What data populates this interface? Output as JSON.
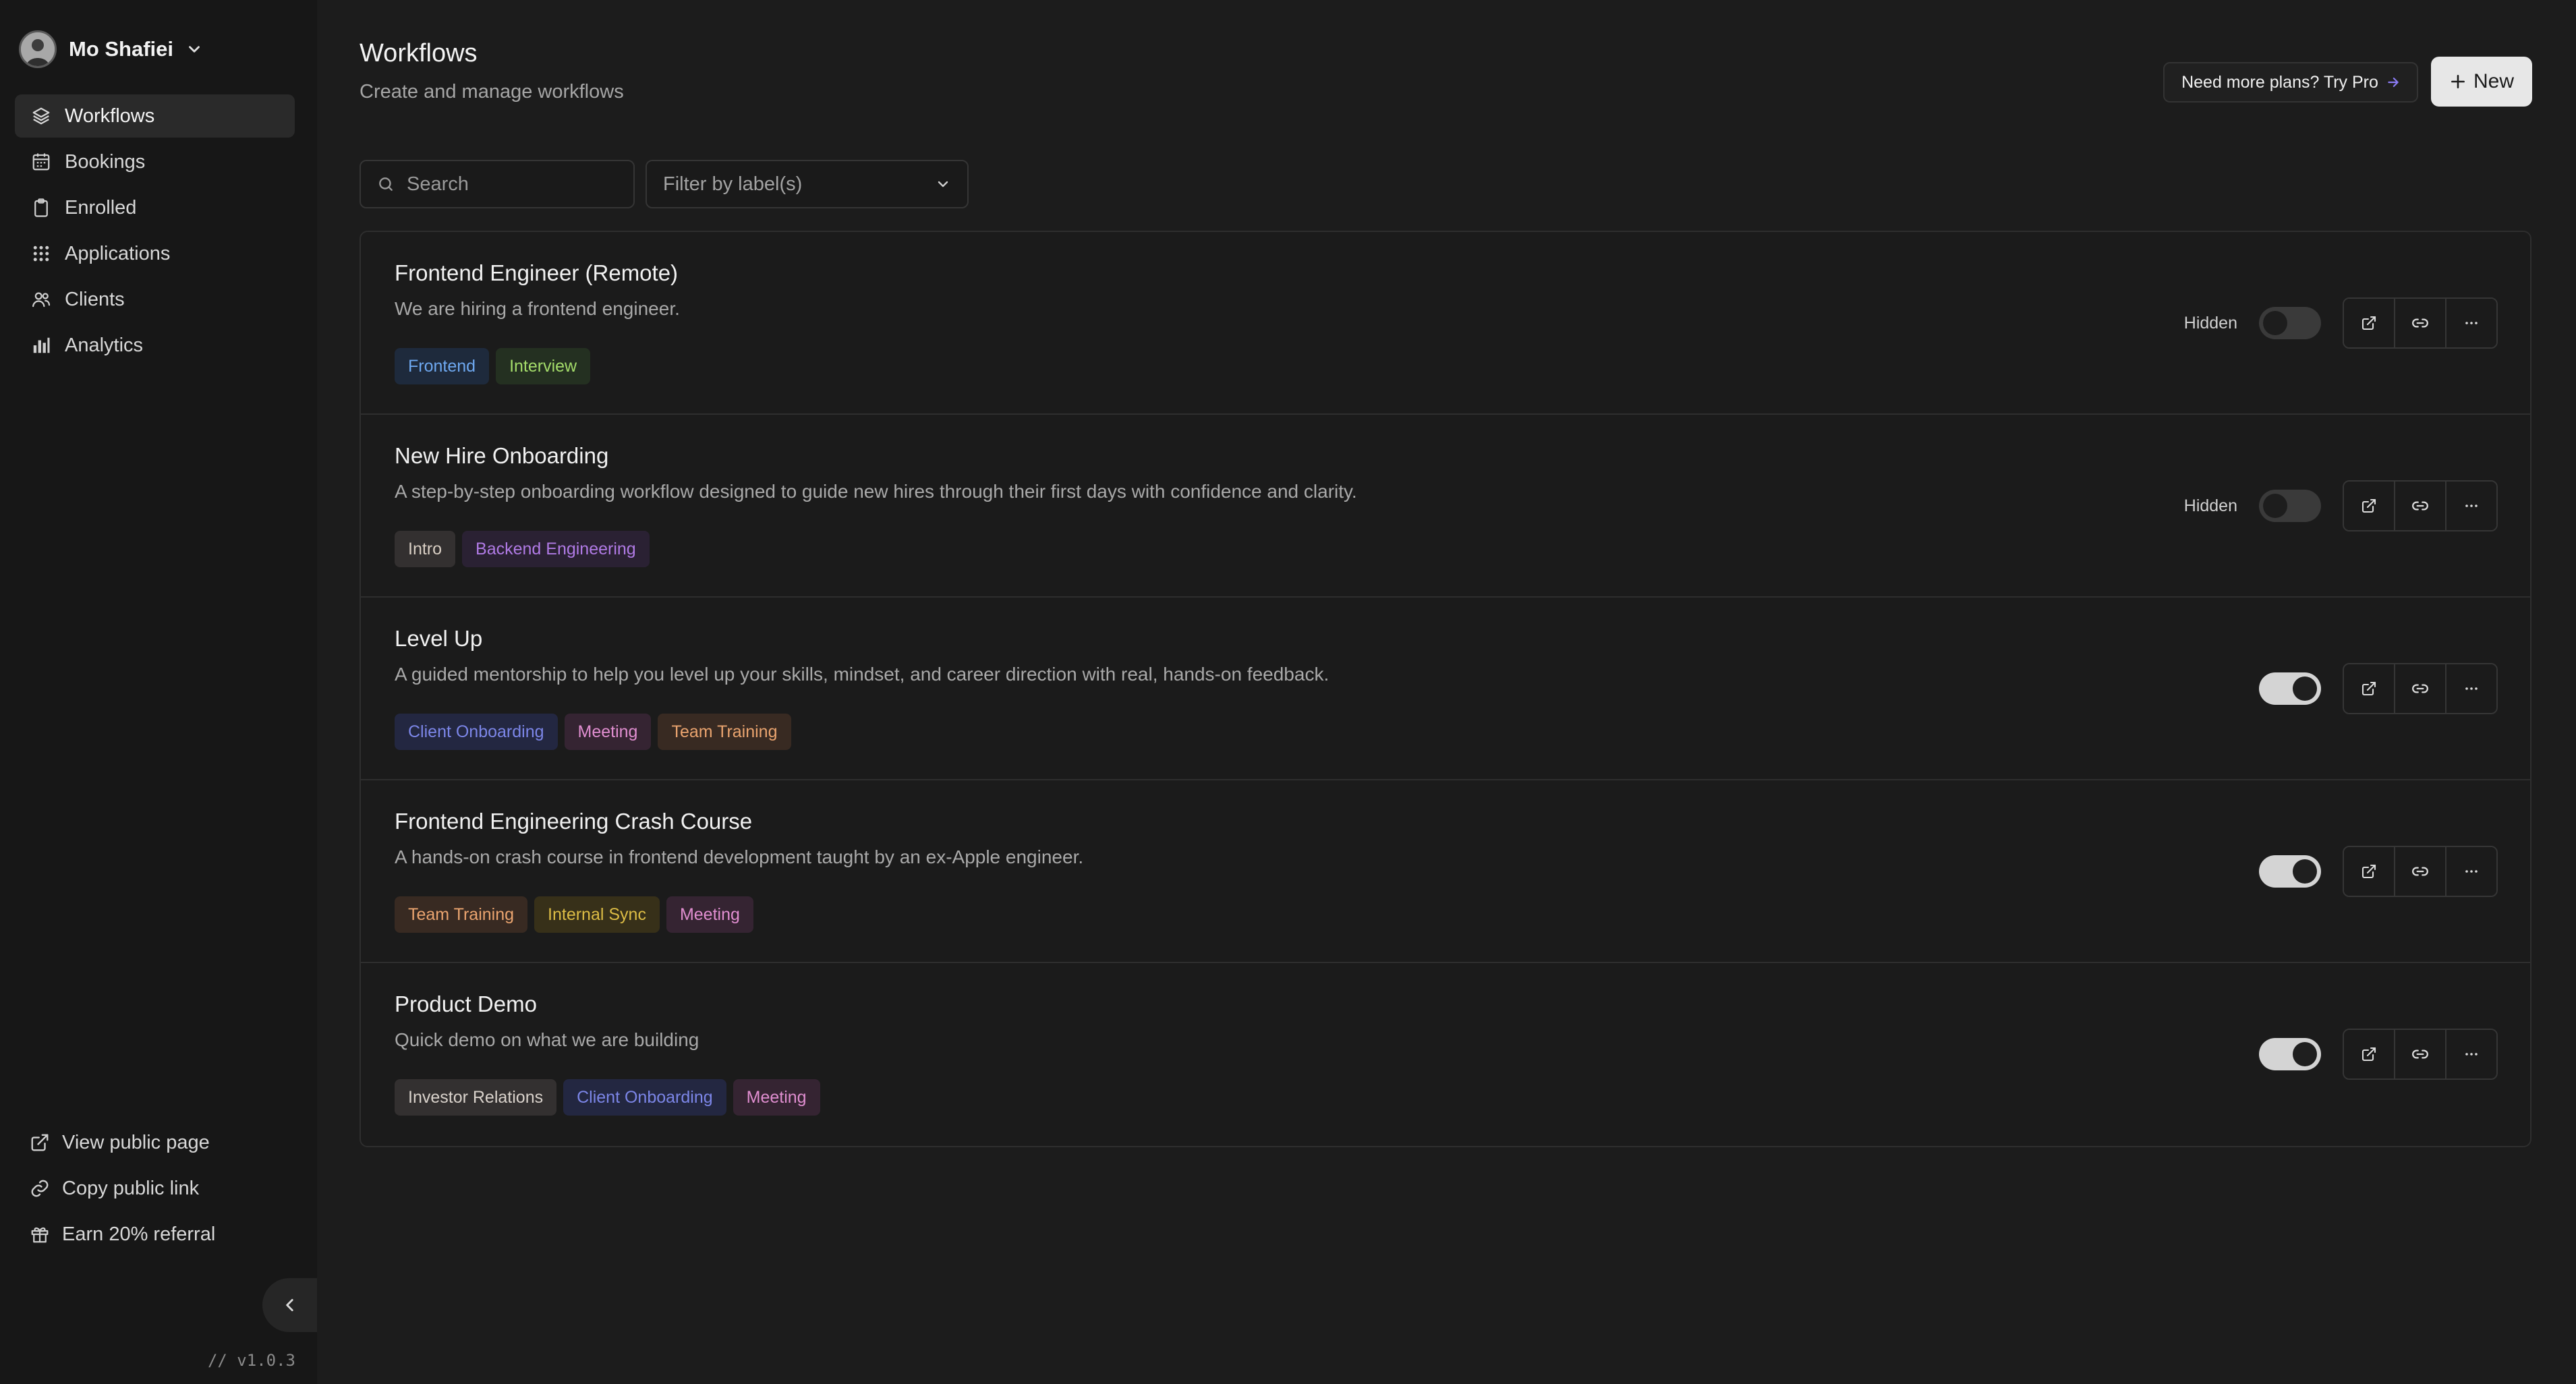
{
  "user": {
    "name": "Mo Shafiei"
  },
  "sidebar": {
    "items": [
      {
        "label": "Workflows",
        "icon": "layers-icon",
        "active": true
      },
      {
        "label": "Bookings",
        "icon": "calendar-icon"
      },
      {
        "label": "Enrolled",
        "icon": "clipboard-icon"
      },
      {
        "label": "Applications",
        "icon": "grid-icon"
      },
      {
        "label": "Clients",
        "icon": "users-icon"
      },
      {
        "label": "Analytics",
        "icon": "bar-chart-icon"
      }
    ],
    "bottom": [
      {
        "label": "View public page",
        "icon": "external-link-icon"
      },
      {
        "label": "Copy public link",
        "icon": "link-icon"
      },
      {
        "label": "Earn 20% referral",
        "icon": "gift-icon"
      }
    ],
    "version": "// v1.0.3"
  },
  "header": {
    "title": "Workflows",
    "subtitle": "Create and manage workflows",
    "pro_label": "Need more plans? Try Pro",
    "new_label": "New"
  },
  "filters": {
    "search_placeholder": "Search",
    "label_filter": "Filter by label(s)"
  },
  "colors": {
    "accent_arrow": "#8b7cf6",
    "tag_frontend": {
      "bg": "#1e2a3c",
      "fg": "#6ea8f0"
    },
    "tag_interview": {
      "bg": "#243021",
      "fg": "#a4dc6a"
    },
    "tag_intro": {
      "bg": "#333030",
      "fg": "#d9cfc4"
    },
    "tag_backend": {
      "bg": "#2a2133",
      "fg": "#b17be6"
    },
    "tag_client_onboarding": {
      "bg": "#232741",
      "fg": "#7c86e8"
    },
    "tag_meeting": {
      "bg": "#352432",
      "fg": "#e08ed0"
    },
    "tag_team_training": {
      "bg": "#382a22",
      "fg": "#eaa46f"
    },
    "tag_internal_sync": {
      "bg": "#373019",
      "fg": "#dcbc45"
    },
    "tag_investor": {
      "bg": "#333030",
      "fg": "#dad3cc"
    }
  },
  "workflows": [
    {
      "title": "Frontend Engineer (Remote)",
      "description": "We are hiring a frontend engineer.",
      "tags": [
        {
          "label": "Frontend",
          "color": "tag_frontend"
        },
        {
          "label": "Interview",
          "color": "tag_interview"
        }
      ],
      "status": "Hidden",
      "enabled": false
    },
    {
      "title": "New Hire Onboarding",
      "description": "A step-by-step onboarding workflow designed to guide new hires through their first days with confidence and clarity.",
      "tags": [
        {
          "label": "Intro",
          "color": "tag_intro"
        },
        {
          "label": "Backend Engineering",
          "color": "tag_backend"
        }
      ],
      "status": "Hidden",
      "enabled": false
    },
    {
      "title": "Level Up",
      "description": "A guided mentorship to help you level up your skills, mindset, and career direction with real, hands-on feedback.",
      "tags": [
        {
          "label": "Client Onboarding",
          "color": "tag_client_onboarding"
        },
        {
          "label": "Meeting",
          "color": "tag_meeting"
        },
        {
          "label": "Team Training",
          "color": "tag_team_training"
        }
      ],
      "status": "",
      "enabled": true
    },
    {
      "title": "Frontend Engineering Crash Course",
      "description": "A hands-on crash course in frontend development taught by an ex-Apple engineer.",
      "tags": [
        {
          "label": "Team Training",
          "color": "tag_team_training"
        },
        {
          "label": "Internal Sync",
          "color": "tag_internal_sync"
        },
        {
          "label": "Meeting",
          "color": "tag_meeting"
        }
      ],
      "status": "",
      "enabled": true
    },
    {
      "title": "Product Demo",
      "description": "Quick demo on what we are building",
      "tags": [
        {
          "label": "Investor Relations",
          "color": "tag_investor"
        },
        {
          "label": "Client Onboarding",
          "color": "tag_client_onboarding"
        },
        {
          "label": "Meeting",
          "color": "tag_meeting"
        }
      ],
      "status": "",
      "enabled": true
    }
  ]
}
